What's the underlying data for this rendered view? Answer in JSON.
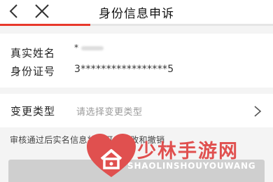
{
  "header": {
    "title": "身份信息申诉",
    "back_icon": "chevron-left-icon",
    "close_icon": "close-icon",
    "progress_fraction": 0.33,
    "accent_color": "#e8382b"
  },
  "identity": {
    "name_label": "真实姓名",
    "name_value": "*",
    "id_label": "身份证号",
    "id_value": "3*****************5"
  },
  "change_type": {
    "label": "变更类型",
    "placeholder": "请选择变更类型",
    "chevron_icon": "chevron-right-icon"
  },
  "notice": "审核通过后实名信息将不可以修改和撤销",
  "watermark": {
    "title": "少林手游网",
    "subtitle": "SHAOLINSHOUYOUWANG",
    "color": "#e0504f"
  }
}
